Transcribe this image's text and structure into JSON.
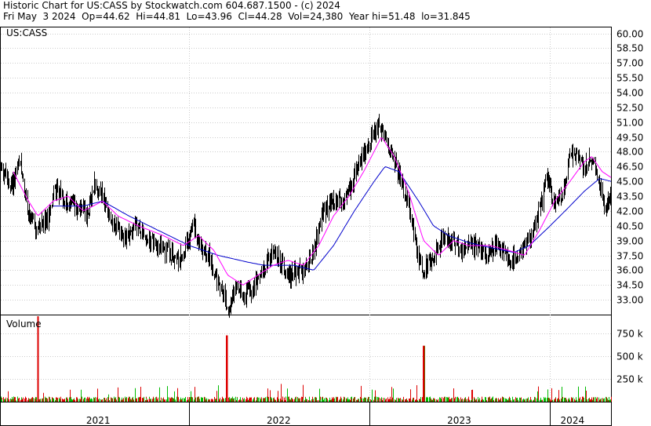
{
  "header": {
    "line1": "Historic Chart for US:CASS by Stockwatch.com 604.687.1500 - (c) 2024",
    "line2": "Fri May  3 2024  Op=44.62  Hi=44.81  Lo=43.96  Cl=44.28  Vol=24,380  Year hi=51.48  lo=31.845"
  },
  "chart_data": [
    {
      "type": "line",
      "title": "US:CASS",
      "ylim": [
        31.5,
        60.6
      ],
      "y_ticks": [
        "60.00",
        "58.50",
        "57.00",
        "55.50",
        "54.00",
        "52.50",
        "51.00",
        "49.50",
        "48.00",
        "46.50",
        "45.00",
        "43.50",
        "42.00",
        "40.50",
        "39.00",
        "37.50",
        "36.00",
        "34.50",
        "33.00"
      ],
      "x_axis": {
        "start": "2020-12-16",
        "end": "2024-05-03",
        "year_boundaries": [
          "2022-01-01",
          "2023-01-01",
          "2024-01-01"
        ],
        "year_labels": [
          {
            "label": "2021",
            "center": "2021-07-01"
          },
          {
            "label": "2022",
            "center": "2022-07-01"
          },
          {
            "label": "2023",
            "center": "2023-07-01"
          },
          {
            "label": "2024",
            "center": "2024-02-15"
          }
        ]
      },
      "colors": {
        "price": "#000000",
        "ma_short": "#ff00ff",
        "ma_long": "#0000cc",
        "grid": "#cccccc"
      },
      "price_anchors": [
        [
          "2020-12-16",
          46.5
        ],
        [
          "2021-01-05",
          44.5
        ],
        [
          "2021-01-25",
          47.0
        ],
        [
          "2021-02-10",
          41.5
        ],
        [
          "2021-02-25",
          40.0
        ],
        [
          "2021-03-20",
          41.0
        ],
        [
          "2021-04-05",
          44.5
        ],
        [
          "2021-04-25",
          43.0
        ],
        [
          "2021-05-20",
          42.5
        ],
        [
          "2021-06-10",
          41.5
        ],
        [
          "2021-06-22",
          45.0
        ],
        [
          "2021-07-10",
          43.5
        ],
        [
          "2021-08-01",
          40.5
        ],
        [
          "2021-08-25",
          39.5
        ],
        [
          "2021-09-20",
          40.5
        ],
        [
          "2021-10-20",
          38.5
        ],
        [
          "2021-11-20",
          38.0
        ],
        [
          "2021-12-10",
          37.0
        ],
        [
          "2022-01-10",
          40.5
        ],
        [
          "2022-01-25",
          38.0
        ],
        [
          "2022-02-10",
          37.5
        ],
        [
          "2022-03-01",
          34.5
        ],
        [
          "2022-03-20",
          32.5
        ],
        [
          "2022-04-05",
          34.0
        ],
        [
          "2022-04-20",
          33.5
        ],
        [
          "2022-05-10",
          34.0
        ],
        [
          "2022-06-01",
          36.5
        ],
        [
          "2022-06-20",
          38.0
        ],
        [
          "2022-07-10",
          36.5
        ],
        [
          "2022-07-25",
          35.5
        ],
        [
          "2022-08-20",
          36.0
        ],
        [
          "2022-09-10",
          38.0
        ],
        [
          "2022-09-25",
          41.5
        ],
        [
          "2022-10-20",
          43.0
        ],
        [
          "2022-11-10",
          43.0
        ],
        [
          "2022-12-05",
          46.0
        ],
        [
          "2022-12-25",
          48.5
        ],
        [
          "2023-01-20",
          50.5
        ],
        [
          "2023-02-10",
          48.5
        ],
        [
          "2023-03-01",
          45.5
        ],
        [
          "2023-03-20",
          43.0
        ],
        [
          "2023-04-05",
          38.0
        ],
        [
          "2023-04-20",
          36.0
        ],
        [
          "2023-05-10",
          37.5
        ],
        [
          "2023-06-01",
          39.5
        ],
        [
          "2023-06-20",
          38.5
        ],
        [
          "2023-07-10",
          38.0
        ],
        [
          "2023-08-05",
          38.5
        ],
        [
          "2023-08-25",
          37.5
        ],
        [
          "2023-09-15",
          38.5
        ],
        [
          "2023-10-10",
          37.0
        ],
        [
          "2023-10-25",
          37.5
        ],
        [
          "2023-11-10",
          38.5
        ],
        [
          "2023-11-25",
          39.5
        ],
        [
          "2023-12-10",
          42.0
        ],
        [
          "2023-12-25",
          45.5
        ],
        [
          "2024-01-10",
          42.5
        ],
        [
          "2024-01-25",
          43.5
        ],
        [
          "2024-02-10",
          47.5
        ],
        [
          "2024-02-25",
          47.5
        ],
        [
          "2024-03-10",
          46.5
        ],
        [
          "2024-03-25",
          47.5
        ],
        [
          "2024-04-10",
          45.0
        ],
        [
          "2024-04-20",
          42.0
        ],
        [
          "2024-05-03",
          44.3
        ]
      ],
      "ma_short_anchors": [
        [
          "2021-01-10",
          46.0
        ],
        [
          "2021-02-10",
          43.0
        ],
        [
          "2021-03-01",
          41.5
        ],
        [
          "2021-04-01",
          43.0
        ],
        [
          "2021-05-01",
          43.5
        ],
        [
          "2021-06-01",
          42.0
        ],
        [
          "2021-07-10",
          43.0
        ],
        [
          "2021-08-10",
          41.5
        ],
        [
          "2021-09-20",
          40.5
        ],
        [
          "2021-11-10",
          39.5
        ],
        [
          "2021-12-20",
          38.5
        ],
        [
          "2022-01-20",
          39.5
        ],
        [
          "2022-02-20",
          38.0
        ],
        [
          "2022-03-20",
          35.5
        ],
        [
          "2022-04-20",
          34.5
        ],
        [
          "2022-05-20",
          35.5
        ],
        [
          "2022-06-20",
          36.5
        ],
        [
          "2022-07-20",
          37.0
        ],
        [
          "2022-08-20",
          36.5
        ],
        [
          "2022-09-20",
          38.5
        ],
        [
          "2022-10-20",
          41.5
        ],
        [
          "2022-11-20",
          43.5
        ],
        [
          "2022-12-20",
          46.0
        ],
        [
          "2023-01-25",
          49.5
        ],
        [
          "2023-02-20",
          47.5
        ],
        [
          "2023-03-20",
          44.0
        ],
        [
          "2023-04-20",
          39.0
        ],
        [
          "2023-05-20",
          37.5
        ],
        [
          "2023-06-20",
          39.0
        ],
        [
          "2023-07-20",
          38.5
        ],
        [
          "2023-09-01",
          38.5
        ],
        [
          "2023-10-10",
          38.0
        ],
        [
          "2023-11-10",
          37.5
        ],
        [
          "2023-12-10",
          40.0
        ],
        [
          "2024-01-10",
          43.0
        ],
        [
          "2024-02-10",
          45.0
        ],
        [
          "2024-03-10",
          47.0
        ],
        [
          "2024-03-25",
          47.5
        ],
        [
          "2024-04-15",
          46.0
        ],
        [
          "2024-05-03",
          45.4
        ]
      ],
      "ma_long_anchors": [
        [
          "2021-04-01",
          42.5
        ],
        [
          "2021-06-01",
          42.5
        ],
        [
          "2021-07-10",
          43.0
        ],
        [
          "2021-09-01",
          41.5
        ],
        [
          "2021-11-01",
          40.0
        ],
        [
          "2022-01-01",
          38.5
        ],
        [
          "2022-03-01",
          37.5
        ],
        [
          "2022-05-01",
          36.8
        ],
        [
          "2022-06-01",
          36.5
        ],
        [
          "2022-08-01",
          36.5
        ],
        [
          "2022-09-10",
          36.0
        ],
        [
          "2022-10-20",
          38.5
        ],
        [
          "2022-12-01",
          42.0
        ],
        [
          "2023-01-10",
          45.0
        ],
        [
          "2023-02-01",
          46.5
        ],
        [
          "2023-03-01",
          46.0
        ],
        [
          "2023-04-10",
          43.0
        ],
        [
          "2023-05-10",
          40.5
        ],
        [
          "2023-06-10",
          39.5
        ],
        [
          "2023-07-20",
          38.8
        ],
        [
          "2023-09-01",
          38.3
        ],
        [
          "2023-10-20",
          37.8
        ],
        [
          "2023-11-20",
          38.5
        ],
        [
          "2024-01-01",
          40.5
        ],
        [
          "2024-02-10",
          42.5
        ],
        [
          "2024-03-10",
          44.0
        ],
        [
          "2024-04-10",
          45.3
        ],
        [
          "2024-05-03",
          45.0
        ]
      ]
    },
    {
      "type": "bar",
      "title": "Volume",
      "ylim": [
        0,
        950000
      ],
      "y_ticks": [
        {
          "label": "750 k",
          "value": 750000
        },
        {
          "label": "500 k",
          "value": 500000
        },
        {
          "label": "250 k",
          "value": 250000
        }
      ],
      "colors": {
        "up": "#00bb00",
        "down": "#dd0000"
      },
      "typical_volume": 35000,
      "spikes": [
        {
          "date": "2021-02-28",
          "value": 940000
        },
        {
          "date": "2022-03-18",
          "value": 730000
        },
        {
          "date": "2023-04-20",
          "value": 615000
        }
      ]
    }
  ]
}
